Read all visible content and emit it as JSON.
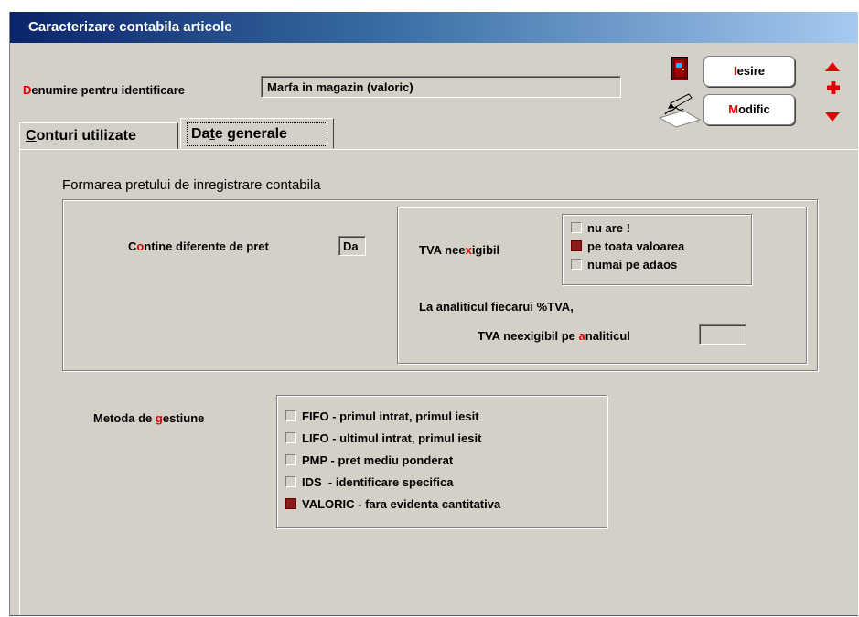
{
  "window": {
    "title": "Caracterizare contabila articole"
  },
  "header": {
    "den_label_hot": "D",
    "den_label_rest": "enumire pentru identificare",
    "den_value": "Marfa in magazin (valoric)"
  },
  "buttons": {
    "iesire_hot": "I",
    "iesire_rest": "esire",
    "modific_hot": "M",
    "modific_rest": "odific"
  },
  "tabs": [
    {
      "hot": "C",
      "rest": "onturi utilizate"
    },
    {
      "pre": "Da",
      "hot": "t",
      "rest": "e generale"
    }
  ],
  "section": {
    "title": "Formarea pretului de inregistrare contabila"
  },
  "diferente": {
    "pre": "C",
    "hot": "o",
    "rest": "ntine diferente de pret",
    "value": "Da"
  },
  "tva": {
    "label_pre": "TVA nee",
    "label_hot": "x",
    "label_rest": "igibil",
    "options": [
      {
        "label": "nu are !",
        "checked": false
      },
      {
        "label": "pe toata valoarea",
        "checked": true
      },
      {
        "label": "numai pe adaos",
        "checked": false
      }
    ],
    "analitic_line1": "La analiticul fiecarui %TVA,",
    "analitic_pre": "TVA neexigibil pe ",
    "analitic_hot": "a",
    "analitic_rest": "naliticul",
    "analitic_value": ""
  },
  "metoda": {
    "label_pre": "Metoda de ",
    "label_hot": "g",
    "label_rest": "estiune",
    "options": [
      {
        "label": "FIFO - primul intrat, primul iesit",
        "checked": false
      },
      {
        "label": "LIFO - ultimul intrat, primul iesit",
        "checked": false
      },
      {
        "label": "PMP - pret mediu ponderat",
        "checked": false
      },
      {
        "label": "IDS  - identificare specifica",
        "checked": false
      },
      {
        "label": "VALORIC - fara evidenta cantitativa",
        "checked": true
      }
    ]
  },
  "colors": {
    "accent_red": "#e00000",
    "checked": "#8b1a1a",
    "face": "#d4d0c8"
  }
}
